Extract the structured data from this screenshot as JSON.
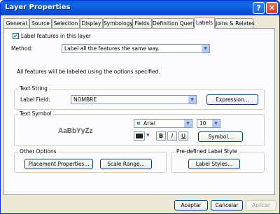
{
  "window": {
    "title": "Layer Properties",
    "help_glyph": "?",
    "close_glyph": "✕"
  },
  "tabs": [
    {
      "label": "General"
    },
    {
      "label": "Source"
    },
    {
      "label": "Selection"
    },
    {
      "label": "Display"
    },
    {
      "label": "Symbology"
    },
    {
      "label": "Fields"
    },
    {
      "label": "Definition Query"
    },
    {
      "label": "Labels",
      "active": true
    },
    {
      "label": "Joins & Relates"
    }
  ],
  "labels_tab": {
    "label_features_checkbox": {
      "label": "Label features in this layer",
      "checked": true,
      "glyph": "✔"
    },
    "method_label": "Method:",
    "method_value": "Label all the features the same way.",
    "info_text": "All features will be labeled using the options specified.",
    "text_string": {
      "group_title": "Text String",
      "label_field_label": "Label Field:",
      "label_field_value": "NOMBRE",
      "expression_button": "Expression..."
    },
    "text_symbol": {
      "group_title": "Text Symbol",
      "sample_text": "AaBbYyZz",
      "font_icon_glyph": "⍺",
      "font_name": "Arial",
      "font_size": "10",
      "color_hex": "#202020",
      "bold_label": "B",
      "italic_label": "I",
      "underline_label": "U",
      "symbol_button": "Symbol..."
    },
    "other_options": {
      "group_title": "Other Options",
      "placement_button": "Placement Properties...",
      "scale_range_button": "Scale Range..."
    },
    "predefined": {
      "group_title": "Pre-defined Label Style",
      "label_styles_button": "Label Styles..."
    }
  },
  "footer": {
    "ok_button": "Aceptar",
    "cancel_button": "Cancelar",
    "apply_button": "Aplicar"
  },
  "dropdown_arrow_glyph": "▼",
  "colors": {
    "titlebar": "#0a5fde",
    "tab_highlight": "#ffc83c",
    "panel_bg": "#fcfcfe",
    "window_bg": "#ece9d8"
  }
}
